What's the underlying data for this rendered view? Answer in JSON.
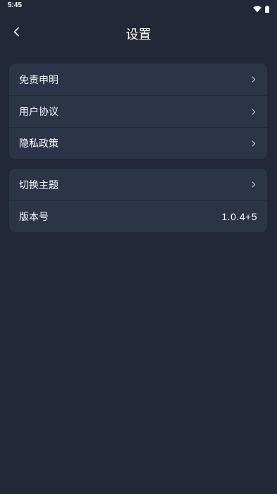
{
  "status_bar": {
    "time": "5:45",
    "wifi_icon": "wifi-icon",
    "battery_icon": "battery-icon"
  },
  "header": {
    "title": "设置",
    "back_icon": "chevron-left-icon"
  },
  "groups": [
    {
      "items": [
        {
          "label": "免责申明",
          "icon": "chevron-right-icon"
        },
        {
          "label": "用户协议",
          "icon": "chevron-right-icon"
        },
        {
          "label": "隐私政策",
          "icon": "chevron-right-icon"
        }
      ]
    },
    {
      "items": [
        {
          "label": "切换主题",
          "icon": "chevron-right-icon"
        },
        {
          "label": "版本号",
          "value": "1.0.4+5"
        }
      ]
    }
  ],
  "colors": {
    "background": "#222837",
    "card": "#2c3447",
    "text": "#ffffff",
    "chevron": "#c8ccd6"
  }
}
